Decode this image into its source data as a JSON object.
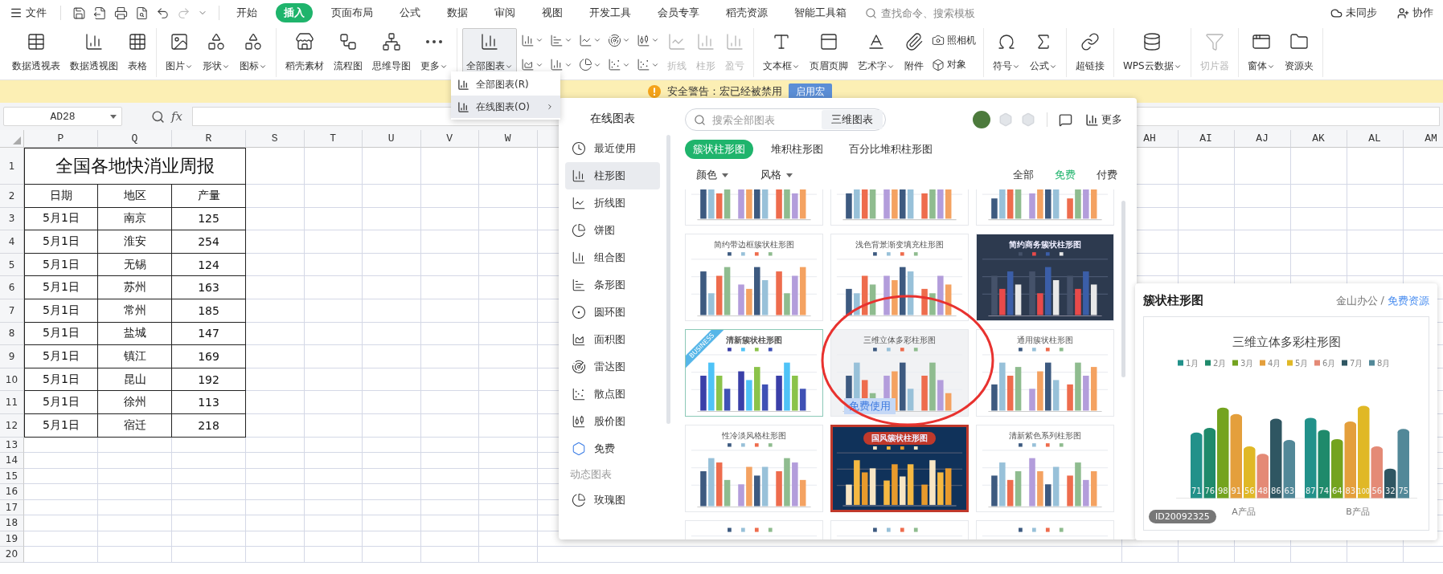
{
  "menu_bar": {
    "file_label": "文件",
    "quick_access": [
      {
        "disabled": false
      },
      {
        "disabled": false
      },
      {
        "disabled": false
      },
      {
        "disabled": false
      },
      {
        "disabled": false
      },
      {
        "disabled": true
      },
      {
        "disabled": false
      }
    ],
    "tabs": [
      {
        "label": "开始",
        "selected": false
      },
      {
        "label": "插入",
        "selected": true
      },
      {
        "label": "页面布局",
        "selected": false
      },
      {
        "label": "公式",
        "selected": false
      },
      {
        "label": "数据",
        "selected": false
      },
      {
        "label": "审阅",
        "selected": false
      },
      {
        "label": "视图",
        "selected": false
      },
      {
        "label": "开发工具",
        "selected": false
      },
      {
        "label": "会员专享",
        "selected": false
      },
      {
        "label": "稻壳资源",
        "selected": false
      },
      {
        "label": "智能工具箱",
        "selected": false
      }
    ],
    "command_search": {
      "placeholder": "查找命令、搜索模板"
    },
    "sync_label": "未同步",
    "collab_label": "协作"
  },
  "ribbon": [
    {
      "items": [
        {
          "kind": "large",
          "label": "数据透视表",
          "menu": false,
          "disabled": false,
          "active": false
        },
        {
          "kind": "large",
          "label": "数据透视图",
          "menu": false,
          "disabled": false,
          "active": false
        },
        {
          "kind": "large",
          "label": "表格",
          "menu": false,
          "disabled": false,
          "active": false
        }
      ]
    },
    {
      "items": [
        {
          "kind": "large",
          "label": "图片",
          "menu": true,
          "disabled": false,
          "active": false
        },
        {
          "kind": "large",
          "label": "形状",
          "menu": true,
          "disabled": false,
          "active": false
        },
        {
          "kind": "large",
          "label": "图标",
          "menu": true,
          "disabled": false,
          "active": false
        }
      ]
    },
    {
      "items": [
        {
          "kind": "large",
          "label": "稻壳素材",
          "menu": false,
          "disabled": false,
          "active": false
        },
        {
          "kind": "large",
          "label": "流程图",
          "menu": false,
          "disabled": false,
          "active": false
        },
        {
          "kind": "large",
          "label": "思维导图",
          "menu": false,
          "disabled": false,
          "active": false
        },
        {
          "kind": "large",
          "label": "更多",
          "menu": true,
          "disabled": false,
          "active": false
        }
      ]
    },
    {
      "items": [
        {
          "kind": "large",
          "label": "全部图表",
          "menu": true,
          "disabled": false,
          "active": true
        },
        {
          "kind": "icon",
          "menu": true
        },
        {
          "kind": "icon",
          "menu": true
        },
        {
          "kind": "icon",
          "menu": true
        },
        {
          "kind": "icon",
          "menu": true
        },
        {
          "kind": "icon",
          "menu": true
        },
        {
          "kind": "icon",
          "menu": true
        },
        {
          "kind": "icon",
          "menu": true
        },
        {
          "kind": "icon",
          "menu": true
        },
        {
          "kind": "icon",
          "menu": true
        },
        {
          "kind": "icon",
          "menu": true
        },
        {
          "kind": "large",
          "label": "折线",
          "menu": false,
          "disabled": true,
          "active": false
        },
        {
          "kind": "large",
          "label": "柱形",
          "menu": false,
          "disabled": true,
          "active": false
        },
        {
          "kind": "large",
          "label": "盈亏",
          "menu": false,
          "disabled": true,
          "active": false
        }
      ]
    },
    {
      "items": [
        {
          "kind": "large",
          "label": "文本框",
          "menu": true,
          "disabled": false,
          "active": false
        },
        {
          "kind": "large",
          "label": "页眉页脚",
          "menu": false,
          "disabled": false,
          "active": false
        },
        {
          "kind": "large",
          "label": "艺术字",
          "menu": true,
          "disabled": false,
          "active": false
        },
        {
          "kind": "large",
          "label": "附件",
          "menu": false,
          "disabled": false,
          "active": false
        },
        {
          "kind": "small",
          "label": "照相机"
        },
        {
          "kind": "small",
          "label": "对象"
        }
      ]
    },
    {
      "items": [
        {
          "kind": "large",
          "label": "符号",
          "menu": true,
          "disabled": false,
          "active": false
        },
        {
          "kind": "large",
          "label": "公式",
          "menu": true,
          "disabled": false,
          "active": false
        }
      ]
    },
    {
      "items": [
        {
          "kind": "large",
          "label": "超链接",
          "menu": false,
          "disabled": false,
          "active": false
        }
      ]
    },
    {
      "items": [
        {
          "kind": "large",
          "label": "WPS云数据",
          "menu": true,
          "disabled": false,
          "active": false
        }
      ]
    },
    {
      "items": [
        {
          "kind": "large",
          "label": "切片器",
          "menu": false,
          "disabled": true,
          "active": false
        }
      ]
    },
    {
      "items": [
        {
          "kind": "large",
          "label": "窗体",
          "menu": true,
          "disabled": false,
          "active": false
        },
        {
          "kind": "large",
          "label": "资源夹",
          "menu": false,
          "disabled": false,
          "active": false
        }
      ]
    }
  ],
  "chart_menu": [
    {
      "label": "全部图表(R)",
      "highlighted": false,
      "submenu": false
    },
    {
      "label": "在线图表(O)",
      "highlighted": true,
      "submenu": true
    }
  ],
  "warning_bar": {
    "message": "安全警告：宏已经被禁用",
    "button": "启用宏"
  },
  "formula_bar": {
    "cell_ref": "AD28",
    "fx_label": "fx"
  },
  "sheet": {
    "columns": [
      "P",
      "Q",
      "R",
      "S",
      "T",
      "U",
      "V",
      "W",
      "AH",
      "AI",
      "AJ",
      "AK",
      "AL",
      "AM"
    ],
    "rows": [
      {
        "num": "1",
        "kind": "title",
        "cells": [
          "全国各地快消业周报"
        ]
      },
      {
        "num": "2",
        "kind": "header",
        "cells": [
          "日期",
          "地区",
          "产量"
        ]
      },
      {
        "num": "3",
        "kind": "data",
        "cells": [
          "5月1日",
          "南京",
          "125"
        ]
      },
      {
        "num": "4",
        "kind": "data",
        "cells": [
          "5月1日",
          "淮安",
          "254"
        ]
      },
      {
        "num": "5",
        "kind": "data",
        "cells": [
          "5月1日",
          "无锡",
          "124"
        ]
      },
      {
        "num": "6",
        "kind": "data",
        "cells": [
          "5月1日",
          "苏州",
          "163"
        ]
      },
      {
        "num": "7",
        "kind": "data",
        "cells": [
          "5月1日",
          "常州",
          "185"
        ]
      },
      {
        "num": "8",
        "kind": "data",
        "cells": [
          "5月1日",
          "盐城",
          "147"
        ]
      },
      {
        "num": "9",
        "kind": "data",
        "cells": [
          "5月1日",
          "镇江",
          "169"
        ]
      },
      {
        "num": "10",
        "kind": "data",
        "cells": [
          "5月1日",
          "昆山",
          "192"
        ]
      },
      {
        "num": "11",
        "kind": "data",
        "cells": [
          "5月1日",
          "徐州",
          "113"
        ]
      },
      {
        "num": "12",
        "kind": "data",
        "cells": [
          "5月1日",
          "宿迁",
          "218"
        ]
      },
      {
        "num": "13",
        "kind": "empty"
      },
      {
        "num": "14",
        "kind": "empty"
      },
      {
        "num": "15",
        "kind": "empty"
      },
      {
        "num": "16",
        "kind": "empty"
      },
      {
        "num": "17",
        "kind": "empty"
      },
      {
        "num": "18",
        "kind": "empty"
      },
      {
        "num": "19",
        "kind": "empty"
      },
      {
        "num": "20",
        "kind": "empty"
      }
    ]
  },
  "online_charts": {
    "title": "在线图表",
    "search": {
      "placeholder": "搜索全部图表",
      "button": "三维图表"
    },
    "more_label": "更多",
    "nav": [
      {
        "label": "最近使用",
        "selected": false
      },
      {
        "label": "柱形图",
        "selected": true
      },
      {
        "label": "折线图",
        "selected": false
      },
      {
        "label": "饼图",
        "selected": false
      },
      {
        "label": "组合图",
        "selected": false
      },
      {
        "label": "条形图",
        "selected": false
      },
      {
        "label": "圆环图",
        "selected": false
      },
      {
        "label": "面积图",
        "selected": false
      },
      {
        "label": "雷达图",
        "selected": false
      },
      {
        "label": "散点图",
        "selected": false
      },
      {
        "label": "股价图",
        "selected": false
      },
      {
        "label": "免费",
        "selected": false
      }
    ],
    "nav_section": "动态图表",
    "nav_extra": [
      {
        "label": "玫瑰图",
        "selected": false
      }
    ],
    "subtabs": [
      {
        "label": "簇状柱形图",
        "selected": true
      },
      {
        "label": "堆积柱形图",
        "selected": false
      },
      {
        "label": "百分比堆积柱形图",
        "selected": false
      }
    ],
    "filters": [
      "颜色",
      "风格"
    ],
    "price_filters": [
      {
        "label": "全部",
        "selected": false
      },
      {
        "label": "免费",
        "selected": true
      },
      {
        "label": "付费",
        "selected": false
      }
    ],
    "cards": [
      {
        "kind": "plain"
      },
      {
        "kind": "plain"
      },
      {
        "kind": "plain"
      },
      {
        "kind": "plain",
        "title": "简约带边框簇状柱形图"
      },
      {
        "kind": "plain",
        "title": "浅色背景渐变填充柱形图"
      },
      {
        "kind": "dark",
        "title": "简约商务簇状柱形图"
      },
      {
        "kind": "framed",
        "title": "清新簇状柱形图",
        "ribbon": "BUSINESS"
      },
      {
        "kind": "plain",
        "title": "三维立体多彩柱形图",
        "free_badge": "免费使用"
      },
      {
        "kind": "plain",
        "title": "通用簇状柱形图"
      },
      {
        "kind": "plain",
        "title": "性冷淡风格柱形图"
      },
      {
        "kind": "navy",
        "title": "国风簇状柱形图"
      },
      {
        "kind": "plain",
        "title": "清新紫色系列柱形图"
      },
      {
        "kind": "plain"
      },
      {
        "kind": "plain"
      },
      {
        "kind": "plain"
      }
    ]
  },
  "preview": {
    "title": "簇状柱形图",
    "source": "金山办公",
    "separator": "/",
    "link": "免费资源",
    "id_badge": "ID20092325",
    "chart_data": {
      "type": "bar",
      "title": "三维立体多彩柱形图",
      "categories": [
        "A产品",
        "B产品"
      ],
      "data_labels": true,
      "legend": true,
      "series": [
        {
          "name": "1月",
          "color": "#22918a",
          "values": [
            71,
            87
          ]
        },
        {
          "name": "2月",
          "color": "#1f8a6b",
          "values": [
            76,
            74
          ]
        },
        {
          "name": "3月",
          "color": "#74a31f",
          "values": [
            98,
            64
          ]
        },
        {
          "name": "4月",
          "color": "#e49f3c",
          "values": [
            91,
            83
          ]
        },
        {
          "name": "5月",
          "color": "#e0b826",
          "values": [
            56,
            100
          ]
        },
        {
          "name": "6月",
          "color": "#e48a76",
          "values": [
            48,
            56
          ]
        },
        {
          "name": "7月",
          "color": "#2f5662",
          "values": [
            86,
            32
          ]
        },
        {
          "name": "8月",
          "color": "#528898",
          "values": [
            63,
            75
          ]
        }
      ]
    }
  }
}
